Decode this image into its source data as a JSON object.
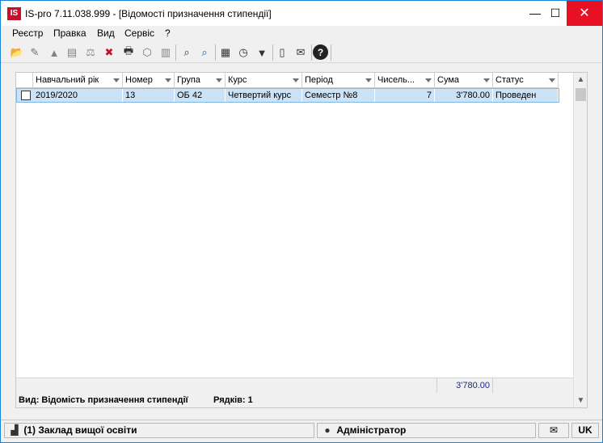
{
  "window": {
    "logo": "IS",
    "title": "IS-pro 7.11.038.999 - [Відомості призначення стипендії]",
    "minimize": "—",
    "maximize": "☐",
    "close": "✕"
  },
  "menu": [
    "Реєстр",
    "Правка",
    "Вид",
    "Сервіс",
    "?"
  ],
  "toolbar": {
    "icons": [
      "open-folder-icon",
      "new-document-icon",
      "copy-icon",
      "paste-icon",
      "scales-icon",
      "delete-red-icon",
      "print-icon",
      "package-icon",
      "document-icon",
      "find-icon",
      "find-next-icon",
      "table-icon",
      "clock-icon",
      "filter-icon",
      "page-icon",
      "mail-icon",
      "help-icon"
    ],
    "glyphs": [
      "📂",
      "✎",
      "▲",
      "▤",
      "⚖",
      "✖",
      "🖶",
      "⬡",
      "▥",
      "⌕",
      "⌕",
      "▦",
      "◷",
      "▼",
      "▯",
      "✉",
      "?"
    ]
  },
  "grid": {
    "columns": [
      "Навчальний рік",
      "Номер",
      "Група",
      "Курс",
      "Період",
      "Чисель...",
      "Сума",
      "Статус"
    ],
    "rows": [
      {
        "checked": false,
        "academic_year": "2019/2020",
        "number": "13",
        "group": "ОБ 42",
        "course": "Четвертий курс",
        "period": "Семестр  №8",
        "count": "7",
        "sum": "3'780.00",
        "status": "Проведен"
      }
    ],
    "total_sum": "3'780.00"
  },
  "info": {
    "view": "Вид: Відомість призначення стипендії",
    "rows": "Рядків: 1"
  },
  "statusbar": {
    "institution": "(1) Заклад вищої освіти",
    "user": "Адміністратор",
    "lang": "UK"
  }
}
